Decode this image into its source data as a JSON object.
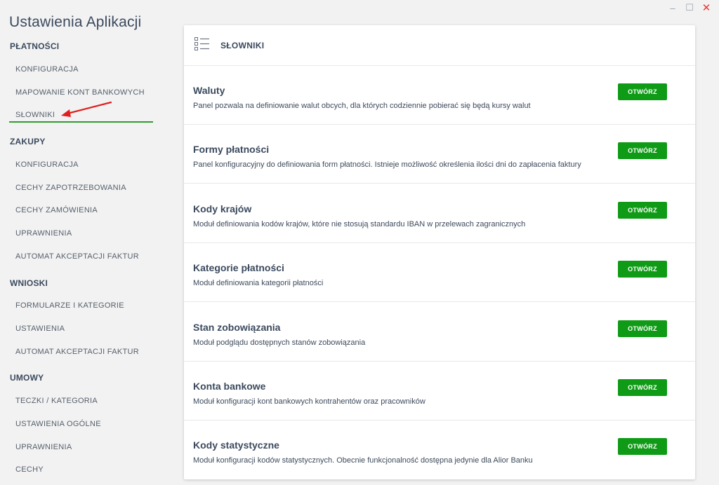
{
  "window": {
    "minimize": "–",
    "maximize": "☐",
    "close": "✕"
  },
  "app_title": "Ustawienia Aplikacji",
  "sidebar": {
    "sections": [
      {
        "label": "PŁATNOŚCI",
        "items": [
          "KONFIGURACJA",
          "MAPOWANIE KONT BANKOWYCH",
          "SŁOWNIKI"
        ]
      },
      {
        "label": "ZAKUPY",
        "items": [
          "KONFIGURACJA",
          "CECHY ZAPOTRZEBOWANIA",
          "CECHY ZAMÓWIENIA",
          "UPRAWNIENIA",
          "AUTOMAT AKCEPTACJI FAKTUR"
        ]
      },
      {
        "label": "WNIOSKI",
        "items": [
          "FORMULARZE I KATEGORIE",
          "USTAWIENIA",
          "AUTOMAT AKCEPTACJI FAKTUR"
        ]
      },
      {
        "label": "UMOWY",
        "items": [
          "TECZKI / KATEGORIA",
          "USTAWIENIA OGÓLNE",
          "UPRAWNIENIA",
          "CECHY"
        ]
      }
    ],
    "active_item": "SŁOWNIKI",
    "accent_color": "#2e9e2e",
    "arrow_color": "#e02020"
  },
  "panel": {
    "title": "SŁOWNIKI",
    "icon": "list-icon",
    "rows": [
      {
        "title": "Waluty",
        "description": "Panel pozwala na definiowanie walut obcych, dla których codziennie pobierać się będą kursy walut",
        "button": "OTWÓRZ"
      },
      {
        "title": "Formy płatności",
        "description": "Panel konfiguracyjny do definiowania form płatności. Istnieje możliwość określenia ilości dni do zapłacenia faktury",
        "button": "OTWÓRZ"
      },
      {
        "title": "Kody krajów",
        "description": "Moduł definiowania kodów krajów, które nie stosują standardu IBAN w przelewach zagranicznych",
        "button": "OTWÓRZ"
      },
      {
        "title": "Kategorie płatności",
        "description": "Moduł definiowania kategorii płatności",
        "button": "OTWÓRZ"
      },
      {
        "title": "Stan zobowiązania",
        "description": "Moduł podglądu dostępnych stanów zobowiązania",
        "button": "OTWÓRZ"
      },
      {
        "title": "Konta bankowe",
        "description": "Moduł konfiguracji kont bankowych kontrahentów oraz pracowników",
        "button": "OTWÓRZ"
      },
      {
        "title": "Kody statystyczne",
        "description": "Moduł konfiguracji kodów statystycznych. Obecnie funkcjonalność dostępna jedynie dla Alior Banku",
        "button": "OTWÓRZ"
      }
    ],
    "button_color": "#0f9b16"
  }
}
